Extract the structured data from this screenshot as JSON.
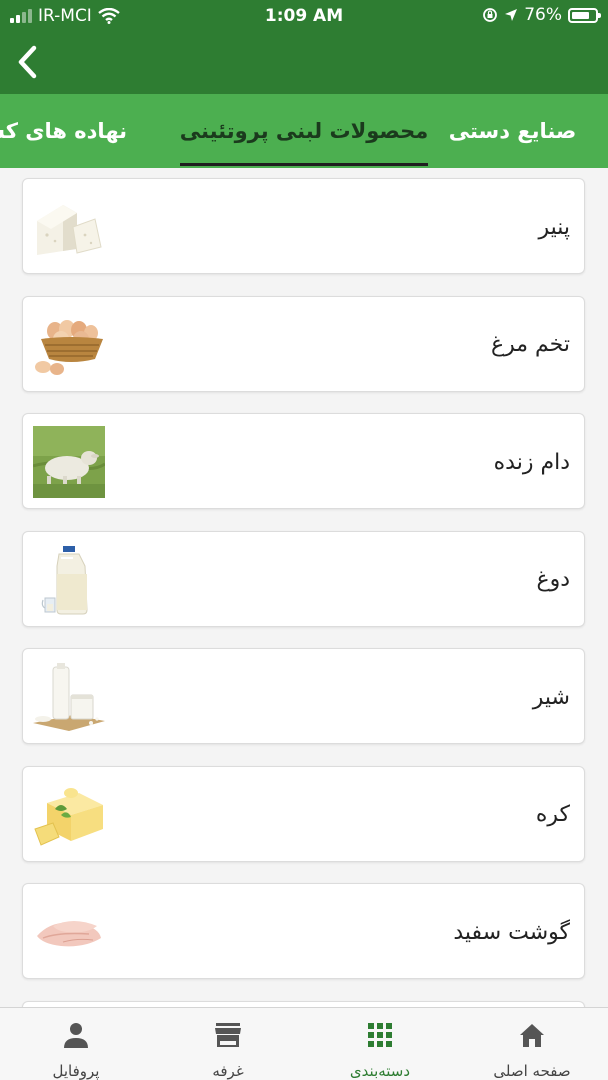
{
  "status_bar": {
    "carrier": "IR-MCI",
    "time": "1:09 AM",
    "battery_percent": "76%",
    "battery_level": 0.76
  },
  "app_bar": {
    "back_icon": "chevron-left-icon"
  },
  "tabs": [
    {
      "label": "صنایع دستی",
      "active": false
    },
    {
      "label": "محصولات لبنی پروتئینی",
      "active": true
    },
    {
      "label": "نهاده های کشاورزی",
      "active": false
    }
  ],
  "items": [
    {
      "label": "پنیر",
      "thumb": "cheese-image"
    },
    {
      "label": "تخم مرغ",
      "thumb": "eggs-basket-image"
    },
    {
      "label": "دام زنده",
      "thumb": "lamb-image"
    },
    {
      "label": "دوغ",
      "thumb": "doogh-bottle-image"
    },
    {
      "label": "شیر",
      "thumb": "milk-image"
    },
    {
      "label": "کره",
      "thumb": "butter-image"
    },
    {
      "label": "گوشت سفید",
      "thumb": "chicken-breast-image"
    }
  ],
  "bottom_nav": [
    {
      "label": "صفحه اصلی",
      "icon": "home-icon",
      "active": false
    },
    {
      "label": "دسته‌بندی",
      "icon": "grid-icon",
      "active": true
    },
    {
      "label": "غرفه",
      "icon": "store-icon",
      "active": false
    },
    {
      "label": "پروفایل",
      "icon": "person-icon",
      "active": false
    }
  ],
  "colors": {
    "header_green": "#2e7d32",
    "tabs_green": "#4caf50",
    "active_nav": "#2e7d32"
  }
}
